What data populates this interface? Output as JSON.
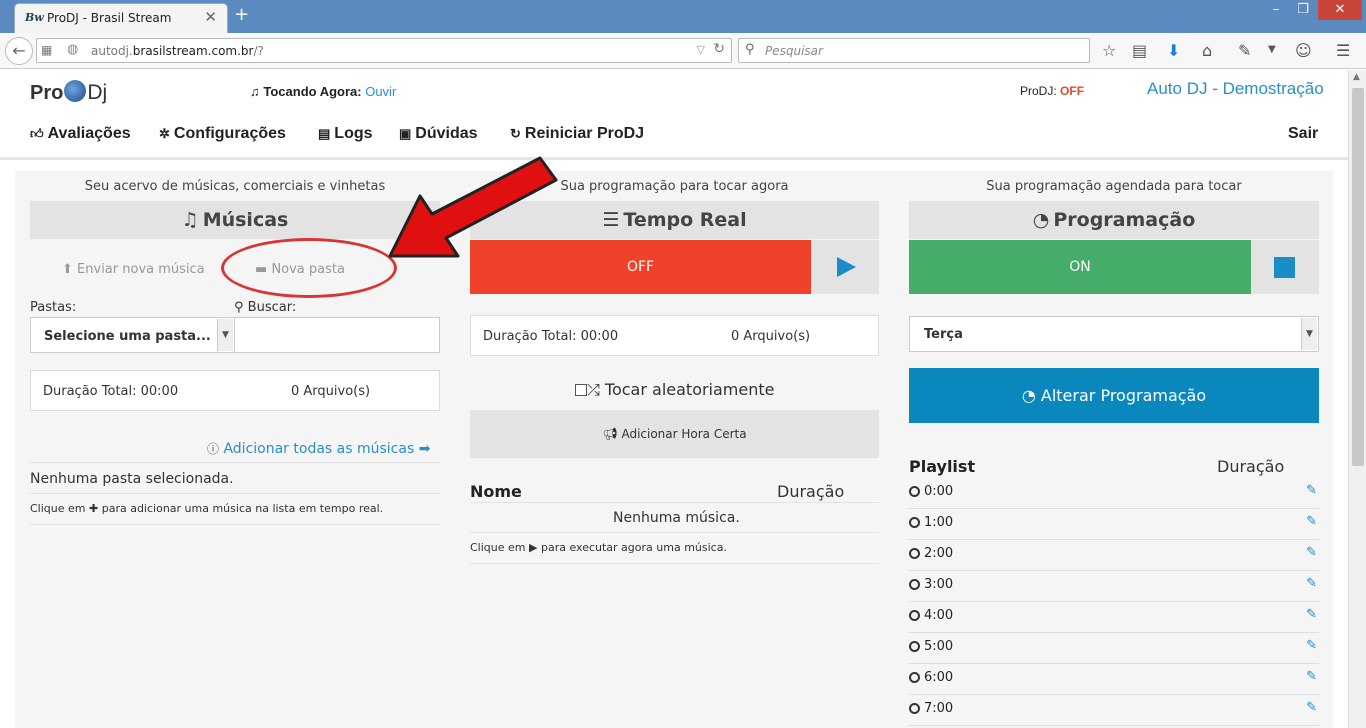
{
  "browser": {
    "tab_favicon": "Bw",
    "tab_title": "ProDJ - Brasil Stream",
    "url_prefix": "autodj.",
    "url_domain": "brasilstream.com.br",
    "url_suffix": "/?",
    "search_placeholder": "Pesquisar"
  },
  "header": {
    "logo_pro": "Pro",
    "logo_dj": "Dj",
    "now_playing_label": "Tocando Agora:",
    "now_playing_link": "Ouvir",
    "status_label": "ProDJ:",
    "status_value": "OFF",
    "site_title": "Auto DJ - Demostração"
  },
  "menu": {
    "avaliacoes": "Avaliações",
    "configuracoes": "Configurações",
    "logs": "Logs",
    "duvidas": "Dúvidas",
    "reiniciar": "Reiniciar ProDJ",
    "sair": "Sair"
  },
  "musicas": {
    "caption": "Seu acervo de músicas, comerciais e vinhetas",
    "title": "Músicas",
    "upload_label": "Enviar nova música",
    "new_folder_label": "Nova pasta",
    "folders_label": "Pastas:",
    "search_label": "Buscar:",
    "folder_select_value": "Selecione uma pasta...",
    "duration_total": "Duração Total: 00:00",
    "file_count": "0 Arquivo(s)",
    "add_all_label": "Adicionar todas as músicas",
    "no_folder": "Nenhuma pasta selecionada.",
    "hint_pre": "Clique em",
    "hint_post": "para adicionar uma música na lista em tempo real."
  },
  "tempo_real": {
    "caption": "Sua programação para tocar agora",
    "title": "Tempo Real",
    "status_button": "OFF",
    "duration_total": "Duração Total: 00:00",
    "file_count": "0 Arquivo(s)",
    "shuffle_label": "Tocar aleatoriamente",
    "hora_certa_label": "Adicionar Hora Certa",
    "col_name": "Nome",
    "col_duration": "Duração",
    "empty": "Nenhuma música.",
    "hint_pre": "Clique em",
    "hint_post": "para executar agora uma música."
  },
  "programacao": {
    "caption": "Sua programação agendada para tocar",
    "title": "Programação",
    "status_button": "ON",
    "day_select_value": "Terça",
    "alter_label": "Alterar Programação",
    "playlist_label": "Playlist",
    "duration_label": "Duração",
    "slots": [
      "0:00",
      "1:00",
      "2:00",
      "3:00",
      "4:00",
      "5:00",
      "6:00",
      "7:00"
    ]
  },
  "colors": {
    "off_red": "#f0412a",
    "on_green": "#46ac6a",
    "accent_blue": "#0a87bd",
    "annotation_red": "#e01010"
  }
}
